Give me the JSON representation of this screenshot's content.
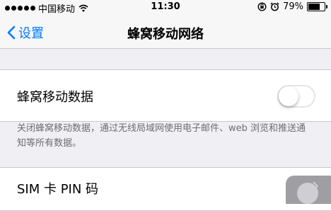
{
  "status_bar": {
    "carrier": "中国移动",
    "time": "11:30",
    "battery": "79%",
    "battery_level": 0.79
  },
  "nav": {
    "back_label": "设置",
    "title": "蜂窝移动网络"
  },
  "cellular_data": {
    "label": "蜂窝移动数据",
    "enabled": false
  },
  "footer_note": "关闭蜂窝移动数据，通过无线局域网使用电子邮件、web 浏览和推送通知等所有数据。",
  "sim_pin": {
    "label": "SIM 卡 PIN 码"
  },
  "icons": [
    "signal-icon",
    "wifi-icon",
    "lock-rotation-icon",
    "alarm-icon",
    "battery-icon",
    "back-chevron-icon",
    "disclosure-chevron-icon"
  ]
}
